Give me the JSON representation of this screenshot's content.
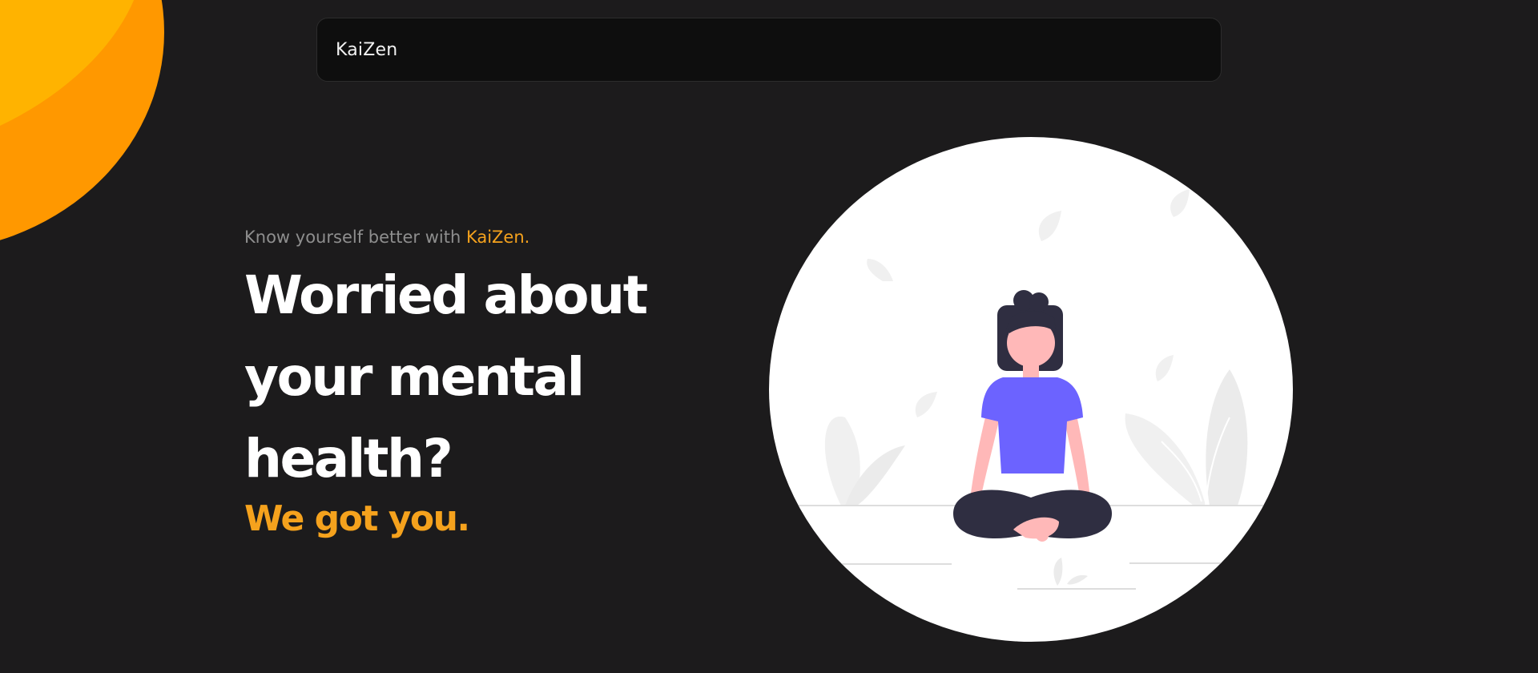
{
  "navbar": {
    "brand": "KaiZen"
  },
  "hero": {
    "tagline_prefix": "Know yourself better with ",
    "tagline_brand": "KaiZen",
    "tagline_suffix": ".",
    "headline_lines": [
      "Worried about",
      "your mental",
      "health?"
    ],
    "subheadline": "We got you."
  },
  "colors": {
    "background": "#1c1b1c",
    "accent": "#f5a21d",
    "blob_primary": "#ffb300",
    "blob_secondary": "#ff9800",
    "shirt": "#6c63ff"
  },
  "illustration": {
    "icon": "meditation-illustration"
  }
}
